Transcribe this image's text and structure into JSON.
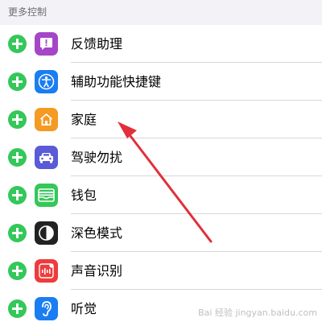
{
  "section": {
    "title": "更多控制"
  },
  "items": [
    {
      "label": "反馈助理",
      "icon": "feedback-assistant-icon",
      "color": "#a446c7"
    },
    {
      "label": "辅助功能快捷键",
      "icon": "accessibility-icon",
      "color": "#1a7df2"
    },
    {
      "label": "家庭",
      "icon": "home-icon",
      "color": "#f59a23"
    },
    {
      "label": "驾驶勿扰",
      "icon": "car-icon",
      "color": "#5a5bd6"
    },
    {
      "label": "钱包",
      "icon": "wallet-icon",
      "color": "#34c759"
    },
    {
      "label": "深色模式",
      "icon": "dark-mode-icon",
      "color": "#222222"
    },
    {
      "label": "声音识别",
      "icon": "sound-recognition-icon",
      "color": "#ef3b3b"
    },
    {
      "label": "听觉",
      "icon": "hearing-icon",
      "color": "#1a7df2"
    }
  ],
  "colors": {
    "add": "#34c759",
    "annotation_arrow": "#e0303a"
  },
  "watermark": "Bai 经验 jingyan.baidu.com"
}
